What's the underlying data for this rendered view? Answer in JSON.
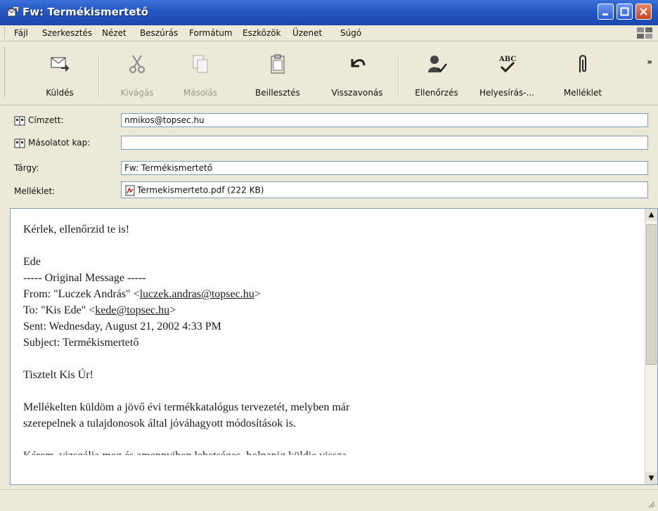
{
  "window": {
    "title": "Fw: Termékismertető"
  },
  "menu": [
    "Fájl",
    "Szerkesztés",
    "Nézet",
    "Beszúrás",
    "Formátum",
    "Eszközök",
    "Üzenet",
    "Súgó"
  ],
  "toolbar": {
    "send": "Küldés",
    "cut": "Kivágás",
    "copy": "Másolás",
    "paste": "Beillesztés",
    "undo": "Visszavonás",
    "check": "Ellenőrzés",
    "spelling": "Helyesírás-...",
    "attach": "Melléklet",
    "more": "»"
  },
  "header": {
    "to_label": "Címzett:",
    "to_value": "nmikos@topsec.hu",
    "cc_label": "Másolatot kap:",
    "cc_value": "",
    "subject_label": "Tárgy:",
    "subject_value": "Fw: Termékismertető",
    "attach_label": "Melléklet:",
    "attach_value": "Termekismertetо.pdf (222 KB)"
  },
  "body": {
    "line1": "Kérlek, ellenőrzid te is!",
    "line2": "Ede",
    "line3": "----- Original Message -----",
    "from_prefix": "From: \"Luczek András\" <",
    "from_link": "luczek.andras@topsec.hu",
    "from_suffix": ">",
    "to_prefix": "To: \"Kis Ede\" <",
    "to_link": "kede@topsec.hu",
    "to_suffix": ">",
    "sent": "Sent: Wednesday, August 21, 2002 4:33 PM",
    "subject": "Subject: Termékismertető",
    "greeting": "Tisztelt Kis Úr!",
    "para1": "Mellékelten küldöm a jövő évi termékkatalógus tervezetét, melyben már",
    "para2": "szerepelnek a tulajdonosok által jóváhagyott módosítások is.",
    "para3": "Kérem, vizsgálja meg és amennyiben lehetséges, holnapig küldje vissza."
  }
}
